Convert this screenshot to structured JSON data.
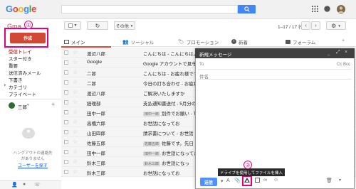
{
  "header": {
    "logo": "Google",
    "logo_letters": [
      {
        "ch": "G",
        "color": "#4285f4"
      },
      {
        "ch": "o",
        "color": "#ea4335"
      },
      {
        "ch": "o",
        "color": "#fbbc05"
      },
      {
        "ch": "g",
        "color": "#4285f4"
      },
      {
        "ch": "l",
        "color": "#34a853"
      },
      {
        "ch": "e",
        "color": "#ea4335"
      }
    ],
    "search_placeholder": ""
  },
  "toolbar": {
    "mail_label": "Gma",
    "more_label": "その他",
    "page_info": "1–17 / 17 行"
  },
  "compose": {
    "label": "作成",
    "annotation_number": "①"
  },
  "sidebar": {
    "items": [
      {
        "label": "受信トレイ",
        "active": true
      },
      {
        "label": "スター付き"
      },
      {
        "label": "重要"
      },
      {
        "label": "送信済みメール"
      },
      {
        "label": "下書き"
      },
      {
        "label": "カテゴリ"
      },
      {
        "label": "プライベート"
      }
    ],
    "user": "三郎",
    "hangouts_text_1": "ハングアウトの連絡先",
    "hangouts_text_2": "がありません",
    "hangouts_link": "ユーザーを探す"
  },
  "tabs": [
    {
      "label": "メイン",
      "active": true
    },
    {
      "label": "ソーシャル"
    },
    {
      "label": "プロモーション"
    },
    {
      "label": "新着"
    },
    {
      "label": "フォーラム"
    }
  ],
  "emails": [
    {
      "sender": "渡辺八郎",
      "subject": "こんにちは - こんにちは。",
      "badge": ""
    },
    {
      "sender": "Google",
      "subject": "Google アカウントで見守り",
      "badge": ""
    },
    {
      "sender": "二郎",
      "subject": "こんにちは - お疲れ様です",
      "badge": ""
    },
    {
      "sender": "二郎",
      "subject": "今日の打ち合わせ - お疲れ",
      "badge": ""
    },
    {
      "sender": "渡辺八郎",
      "subject": "ご解決いたしますか",
      "badge": ""
    },
    {
      "sender": "経理部",
      "subject": "支払通知書送付 - 5月分の",
      "badge": ""
    },
    {
      "sender": "田中一郎",
      "subject": "別件でお願い - T",
      "badge": "田中一郎"
    },
    {
      "sender": "高橋六郎",
      "subject": "お世話になってお",
      "badge": ""
    },
    {
      "sender": "山田四郎",
      "subject": "請求書について - お世話",
      "badge": ""
    },
    {
      "sender": "佐藤五郎",
      "subject": "佐藤です。先日",
      "badge": "佐藤五郎"
    },
    {
      "sender": "田中一郎",
      "subject": "お世話になってお",
      "badge": "田中一郎"
    },
    {
      "sender": "鈴木三郎",
      "subject": "お世話になっ",
      "badge": "鈴木三郎"
    },
    {
      "sender": "鈴木三郎",
      "subject": "お世話になってお",
      "badge": ""
    }
  ],
  "compose_window": {
    "title": "新規メッセージ",
    "to_label": "To",
    "cc_bcc": "Cc Bcc",
    "subject_label": "件名",
    "send_label": "送信",
    "tooltip": "ドライブを使用してファイルを挿入",
    "annotation_number": "②"
  },
  "icons": [
    "search-icon",
    "apps-grid-icon",
    "notification-icon",
    "avatar-icon",
    "refresh-icon",
    "settings-icon",
    "drive-icon",
    "attach-icon",
    "link-icon",
    "emoji-icon",
    "photo-icon",
    "trash-icon"
  ]
}
